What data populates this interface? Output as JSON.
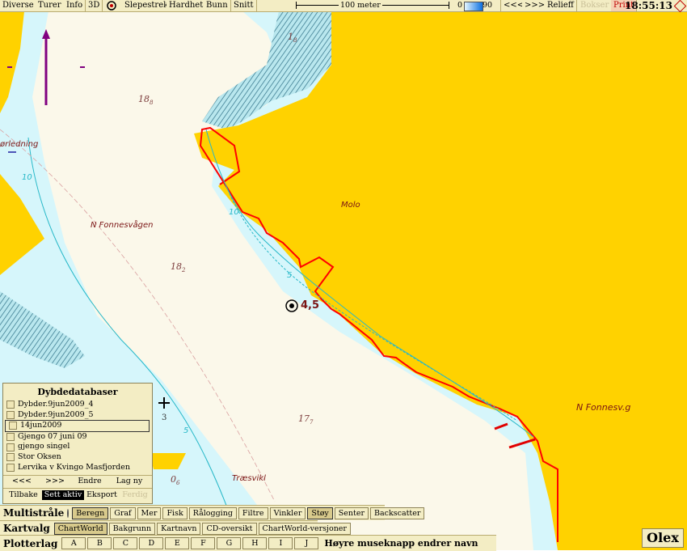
{
  "toolbar": {
    "buttons": [
      "Diverse",
      "Turer",
      "Info",
      "3D"
    ],
    "slepestrek": "Slepestrek",
    "buttons2": [
      "Hardhet",
      "Bunn",
      "Snitt"
    ],
    "scale_label": "100 meter",
    "depth_min": "0",
    "depth_max": "90",
    "prev": "<<<",
    "next": ">>>",
    "relieff": "Relieff",
    "bokser": "Bokser",
    "print": "Print",
    "clock": "18:55:13"
  },
  "map": {
    "labels": {
      "orledning": "ørledning",
      "n_fonnesvagen": "N Fonnesvågen",
      "molo": "Molo",
      "n_fonnesv_g": "N Fonnesv.g",
      "traesvikl": "Træsvikl",
      "d_18_8": "18",
      "d_18_8_sub": "8",
      "d_1_8": "1",
      "d_1_8_sub": "8",
      "d_18_2": "18",
      "d_18_2_sub": "2",
      "d_17_7": "17",
      "d_17_7_sub": "7",
      "d_0_6": "0",
      "d_0_6_sub": "6",
      "d_3": "3",
      "contour_10a": "10",
      "contour_10b": "10",
      "contour_5a": "5",
      "contour_5b": "5",
      "marker_depth": "4,5"
    },
    "colors": {
      "land": "#ffd200",
      "shallow": "#d6f6fb",
      "deep": "#fbf8ea",
      "coast": "#ff0000",
      "contour": "#27b8c8"
    }
  },
  "dybde_panel": {
    "title": "Dybdedatabaser",
    "items": [
      "Dybder.9jun2009_4",
      "Dybder.9jun2009_5",
      "14jun2009",
      "Gjengo 07 juni 09",
      "gjengo singel",
      "Stor Oksen",
      "Lervika v Kvingo Masfjorden"
    ],
    "selected_index": 2,
    "nav": [
      "<<<",
      ">>>",
      "Endre",
      "Lag ny"
    ],
    "actions": [
      "Tilbake",
      "Sett aktiv",
      "Eksport",
      "Ferdig"
    ]
  },
  "multistraale": {
    "label": "Multistråle",
    "buttons": [
      "Beregn",
      "Graf",
      "Mer",
      "Fisk",
      "Rålogging",
      "Filtre",
      "Vinkler",
      "Støy",
      "Senter",
      "Backscatter"
    ]
  },
  "kartvalg": {
    "label": "Kartvalg",
    "buttons": [
      "ChartWorld",
      "Bakgrunn",
      "Kartnavn",
      "CD-oversikt",
      "ChartWorld-versjoner"
    ]
  },
  "plotterlag": {
    "label": "Plotterlag",
    "letters": [
      "A",
      "B",
      "C",
      "D",
      "E",
      "F",
      "G",
      "H",
      "I",
      "J"
    ],
    "hint": "Høyre museknapp endrer navn"
  },
  "brand": "Olex"
}
